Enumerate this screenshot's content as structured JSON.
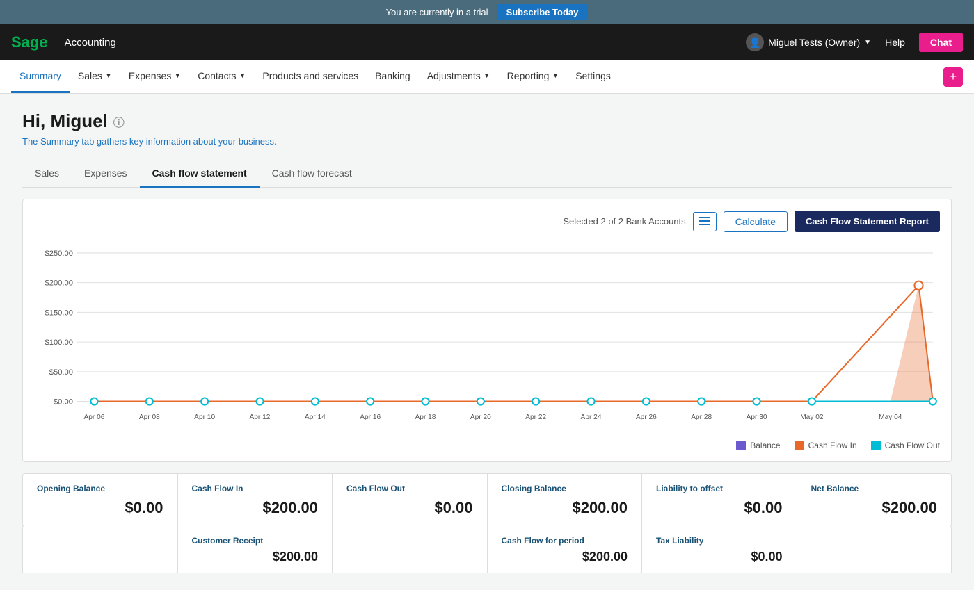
{
  "trial_banner": {
    "message": "You are currently in a trial",
    "subscribe_label": "Subscribe Today"
  },
  "top_nav": {
    "logo": "Sage",
    "app_name": "Accounting",
    "user_name": "Miguel Tests (Owner)",
    "help_label": "Help",
    "chat_label": "Chat"
  },
  "main_nav": {
    "items": [
      {
        "label": "Summary",
        "active": true
      },
      {
        "label": "Sales",
        "has_dropdown": true
      },
      {
        "label": "Expenses",
        "has_dropdown": true
      },
      {
        "label": "Contacts",
        "has_dropdown": true
      },
      {
        "label": "Products and services",
        "has_dropdown": false
      },
      {
        "label": "Banking",
        "has_dropdown": false
      },
      {
        "label": "Adjustments",
        "has_dropdown": true
      },
      {
        "label": "Reporting",
        "has_dropdown": true
      },
      {
        "label": "Settings",
        "has_dropdown": false
      }
    ],
    "plus_label": "+"
  },
  "page": {
    "greeting": "Hi, Miguel",
    "subtitle": "The Summary tab gathers key information about your business."
  },
  "tabs": [
    {
      "label": "Sales",
      "active": false
    },
    {
      "label": "Expenses",
      "active": false
    },
    {
      "label": "Cash flow statement",
      "active": true
    },
    {
      "label": "Cash flow forecast",
      "active": false
    }
  ],
  "chart": {
    "bank_accounts_text": "Selected 2 of 2 Bank Accounts",
    "calculate_label": "Calculate",
    "report_label": "Cash Flow Statement Report",
    "y_labels": [
      "$250.00",
      "$200.00",
      "$150.00",
      "$100.00",
      "$50.00",
      "$0.00"
    ],
    "x_labels": [
      "Apr 06",
      "Apr 08",
      "Apr 10",
      "Apr 12",
      "Apr 14",
      "Apr 16",
      "Apr 18",
      "Apr 20",
      "Apr 22",
      "Apr 24",
      "Apr 26",
      "Apr 28",
      "Apr 30",
      "May 02",
      "May 04"
    ],
    "legend": [
      {
        "label": "Balance",
        "color": "#6a5acd"
      },
      {
        "label": "Cash Flow In",
        "color": "#e8682a"
      },
      {
        "label": "Cash Flow Out",
        "color": "#00bcd4"
      }
    ]
  },
  "summary_cards": [
    {
      "label": "Opening Balance",
      "value": "$0.00"
    },
    {
      "label": "Cash Flow In",
      "value": "$200.00"
    },
    {
      "label": "Cash Flow Out",
      "value": "$0.00"
    },
    {
      "label": "Closing Balance",
      "value": "$200.00"
    },
    {
      "label": "Liability to offset",
      "value": "$0.00"
    },
    {
      "label": "Net Balance",
      "value": "$200.00"
    }
  ],
  "summary_cards_2": [
    {
      "label": "",
      "value": ""
    },
    {
      "label": "Customer Receipt",
      "value": "$200.00"
    },
    {
      "label": "",
      "value": ""
    },
    {
      "label": "Cash Flow for period",
      "value": "$200.00"
    },
    {
      "label": "Tax Liability",
      "value": "$0.00"
    },
    {
      "label": "",
      "value": ""
    }
  ]
}
